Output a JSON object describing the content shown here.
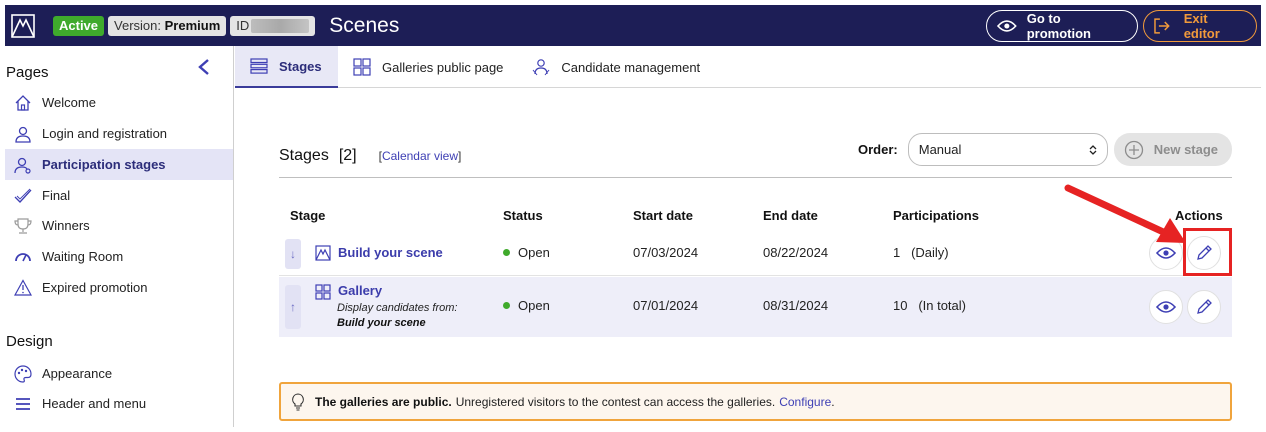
{
  "topbar": {
    "status_badge": "Active",
    "version_label": "Version:",
    "version_value": "Premium",
    "id_label": "ID",
    "title": "Scenes",
    "promo_button": "Go to promotion",
    "exit_button": "Exit editor"
  },
  "sidebar": {
    "pages_heading": "Pages",
    "design_heading": "Design",
    "items": [
      {
        "label": "Welcome",
        "icon": "home-icon"
      },
      {
        "label": "Login and registration",
        "icon": "user-icon"
      },
      {
        "label": "Participation stages",
        "icon": "user-icon"
      },
      {
        "label": "Final",
        "icon": "check-icon"
      },
      {
        "label": "Winners",
        "icon": "trophy-icon"
      },
      {
        "label": "Waiting Room",
        "icon": "speedometer-icon"
      },
      {
        "label": "Expired promotion",
        "icon": "warning-icon"
      }
    ],
    "design_items": [
      {
        "label": "Appearance",
        "icon": "palette-icon"
      },
      {
        "label": "Header and menu",
        "icon": "menu-icon"
      }
    ]
  },
  "tabs": [
    {
      "label": "Stages",
      "icon": "list-icon"
    },
    {
      "label": "Galleries public page",
      "icon": "grid-icon"
    },
    {
      "label": "Candidate management",
      "icon": "candidate-icon"
    }
  ],
  "stages": {
    "title": "Stages",
    "count": "[2]",
    "calendar_open": "[",
    "calendar_link": "Calendar view",
    "calendar_close": "]",
    "order_label": "Order:",
    "order_value": "Manual",
    "new_stage": "New stage",
    "columns": {
      "stage": "Stage",
      "status": "Status",
      "start": "Start date",
      "end": "End date",
      "participations": "Participations",
      "actions": "Actions"
    },
    "rows": [
      {
        "name": "Build your scene",
        "status": "Open",
        "start": "07/03/2024",
        "end": "08/22/2024",
        "participations": "1",
        "participations_note": "(Daily)"
      },
      {
        "name": "Gallery",
        "sub": "Display candidates from:",
        "sub2": "Build your scene",
        "status": "Open",
        "start": "07/01/2024",
        "end": "08/31/2024",
        "participations": "10",
        "participations_note": "(In total)"
      }
    ]
  },
  "notice": {
    "bold": "The galleries are public.",
    "text": "Unregistered visitors to the contest can access the galleries.",
    "link": "Configure",
    "end": "."
  },
  "colors": {
    "topbar": "#1d1e56",
    "accent": "#3e3fb4",
    "active_green": "#3faa2c",
    "exit_orange": "#f19a3b",
    "highlight_red": "#e62323"
  }
}
